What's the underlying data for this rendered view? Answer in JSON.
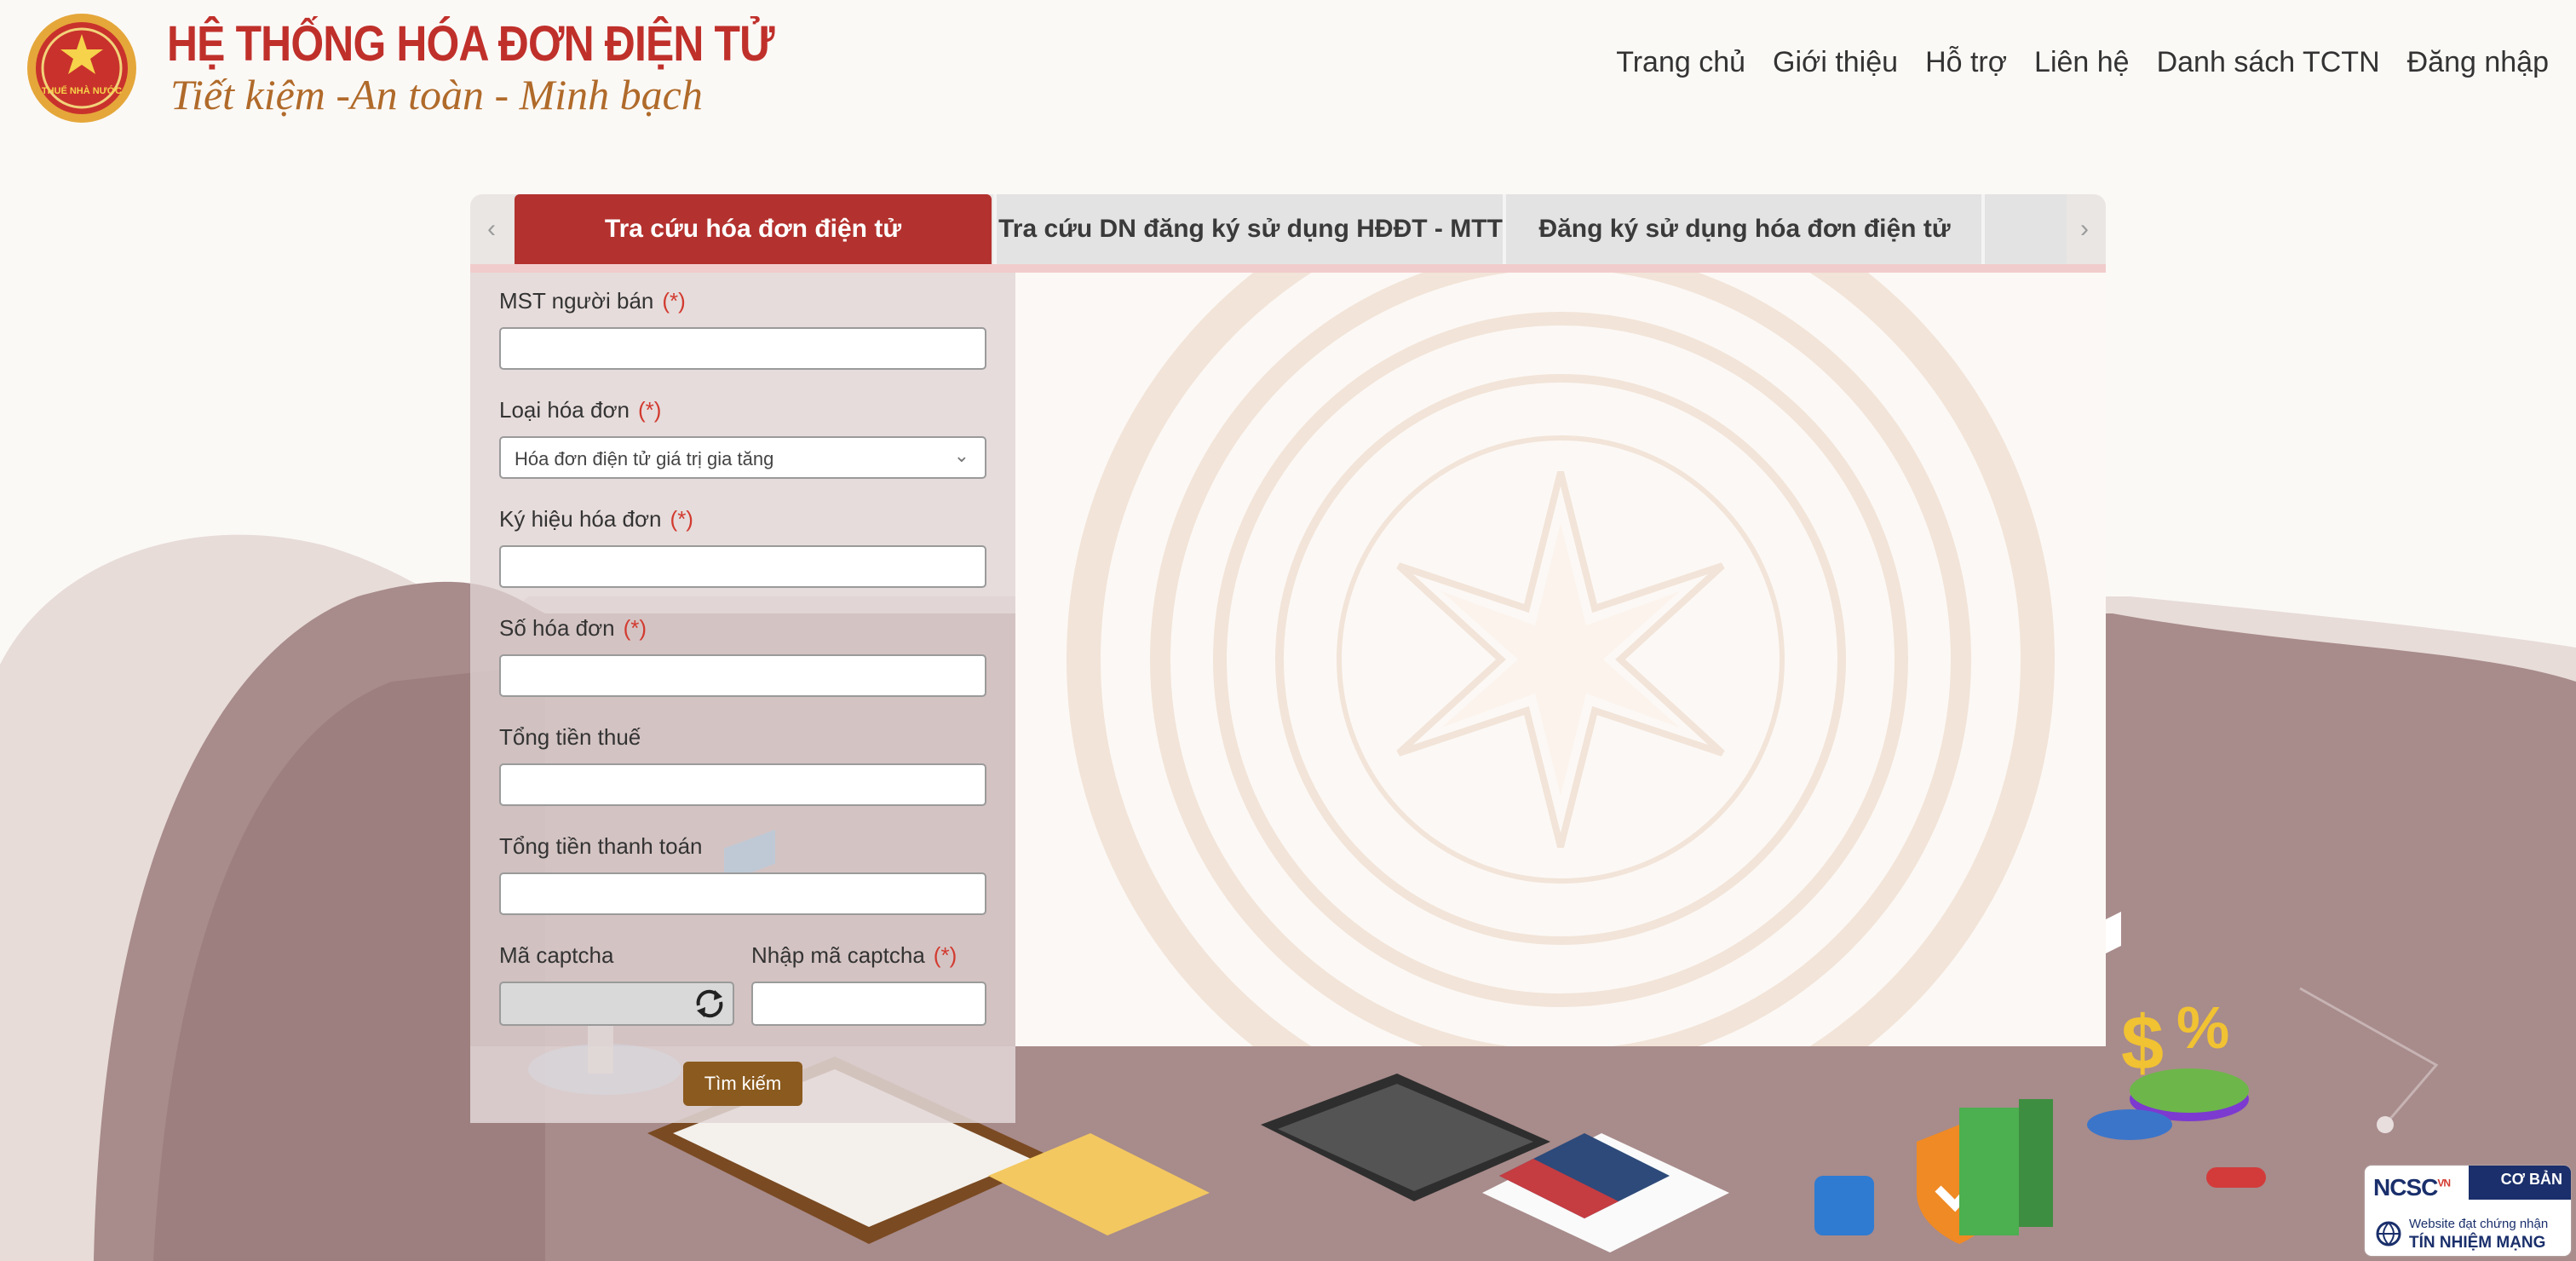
{
  "header": {
    "logo_text": "THUẾ NHÀ NƯỚC",
    "title": "HỆ THỐNG HÓA ĐƠN ĐIỆN TỬ",
    "slogan": "Tiết kiệm -An toàn - Minh bạch",
    "nav": [
      "Trang chủ",
      "Giới thiệu",
      "Hỗ trợ",
      "Liên hệ",
      "Danh sách TCTN",
      "Đăng nhập"
    ]
  },
  "tabs": {
    "prev_arrow": "‹",
    "next_arrow": "›",
    "items": [
      {
        "label": "Tra cứu hóa đơn điện tử",
        "active": true
      },
      {
        "label": "Tra cứu DN đăng ký sử dụng HĐĐT - MTT",
        "active": false
      },
      {
        "label": "Đăng ký sử dụng hóa đơn điện tử",
        "active": false
      }
    ]
  },
  "form": {
    "required_mark": "(*)",
    "seller_tax_code": {
      "label": "MST người bán",
      "value": ""
    },
    "invoice_type": {
      "label": "Loại hóa đơn",
      "selected": "Hóa đơn điện tử giá trị gia tăng"
    },
    "invoice_symbol": {
      "label": "Ký hiệu hóa đơn",
      "value": ""
    },
    "invoice_number": {
      "label": "Số hóa đơn",
      "value": ""
    },
    "total_tax": {
      "label": "Tổng tiền thuế",
      "value": ""
    },
    "total_payment": {
      "label": "Tổng tiền thanh toán",
      "value": ""
    },
    "captcha": {
      "label": "Mã captcha",
      "input_label": "Nhập mã captcha",
      "value": ""
    },
    "search_button": "Tìm kiếm"
  },
  "badge": {
    "ncsc": "NCSC",
    "vn": "VN",
    "tier": "CƠ BẢN",
    "sub": "Website đạt chứng nhận",
    "main": "TÍN NHIỆM MẠNG"
  },
  "decor": {
    "currency": "$",
    "percent": "%"
  }
}
